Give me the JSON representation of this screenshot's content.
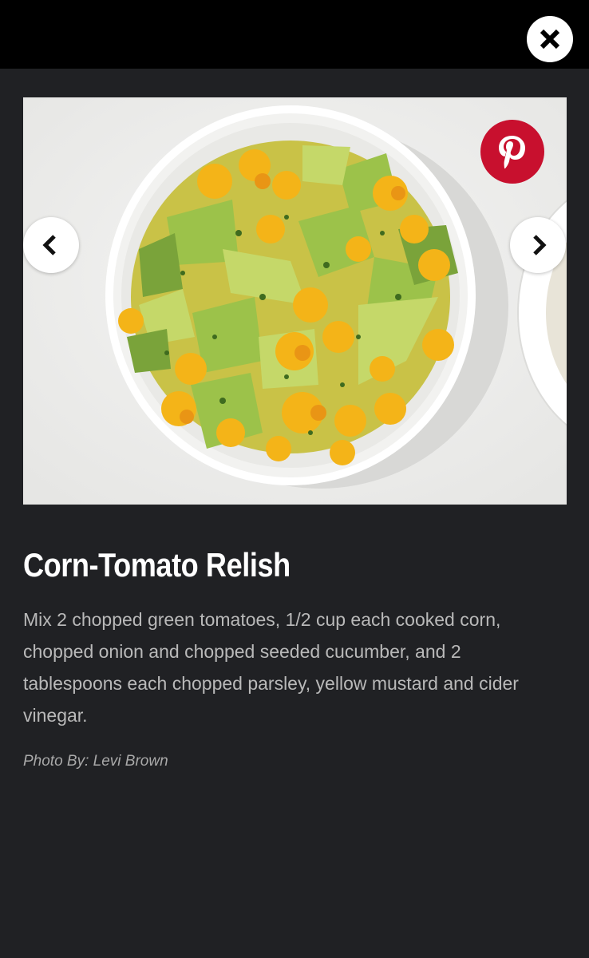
{
  "header": {
    "close_icon": "close-icon"
  },
  "slide": {
    "image_alt": "Corn-Tomato Relish",
    "pinterest_icon": "pinterest-icon",
    "prev_icon": "chevron-left-icon",
    "next_icon": "chevron-right-icon",
    "title": "Corn-Tomato Relish",
    "description": "Mix 2 chopped green tomatoes, 1/2 cup each cooked corn, chopped onion and chopped seeded cucumber, and 2 tablespoons each chopped parsley, yellow mustard and cider vinegar.",
    "credit": "Photo By: Levi Brown"
  },
  "colors": {
    "background": "#202124",
    "topbar": "#000000",
    "pinterest": "#c8102e",
    "title": "#ffffff",
    "body_text": "#b9b9b9"
  }
}
